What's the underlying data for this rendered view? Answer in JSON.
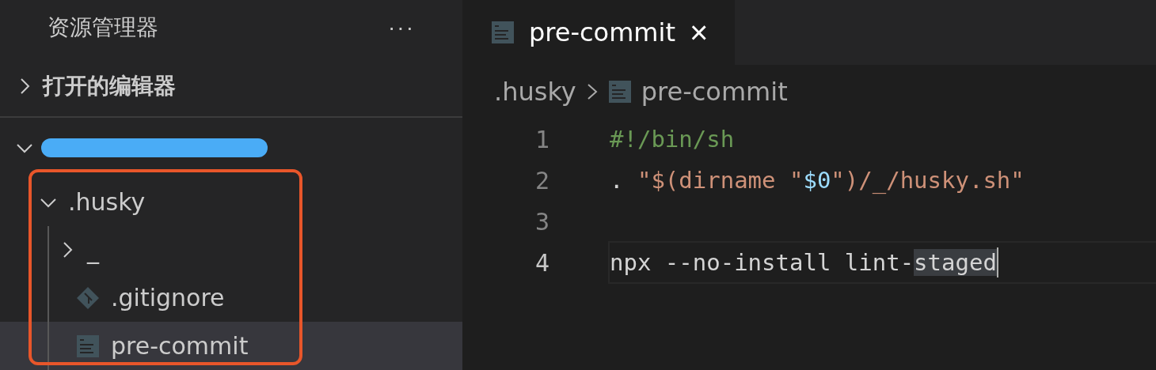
{
  "sidebar": {
    "title": "资源管理器",
    "more": "···",
    "sections": [
      {
        "label": "打开的编辑器",
        "expanded": false,
        "redacted": false
      },
      {
        "expanded": true,
        "redacted": true
      }
    ],
    "tree": [
      {
        "name": ".husky",
        "kind": "folder",
        "expanded": true,
        "selected": false,
        "outlined": true,
        "children": [
          {
            "name": "_",
            "kind": "folder",
            "expanded": false,
            "selected": false
          },
          {
            "name": ".gitignore",
            "kind": "git",
            "selected": false
          },
          {
            "name": "pre-commit",
            "kind": "text",
            "selected": true
          }
        ]
      }
    ]
  },
  "tabs": [
    {
      "label": "pre-commit",
      "selected": true,
      "close": "×"
    }
  ],
  "breadcrumb": [
    {
      "label": ".husky",
      "kind": "folder"
    },
    {
      "label": "pre-commit",
      "kind": "text"
    }
  ],
  "editor": {
    "lines": [
      {
        "number": "1",
        "current": false,
        "tokens": [
          {
            "text": "#!/bin/sh",
            "kind": "comment",
            "highlighted": false
          }
        ]
      },
      {
        "number": "2",
        "current": false,
        "tokens": [
          {
            "text": ". ",
            "kind": "plain",
            "highlighted": false
          },
          {
            "text": "\"$(dirname \"",
            "kind": "string",
            "highlighted": false
          },
          {
            "text": "$0",
            "kind": "variable",
            "highlighted": false
          },
          {
            "text": "\")/_/husky.sh\"",
            "kind": "string",
            "highlighted": false
          }
        ]
      },
      {
        "number": "3",
        "current": false
      },
      {
        "number": "4",
        "current": true,
        "tokens": [
          {
            "text": "npx --no-install lint-",
            "kind": "plain",
            "highlighted": false
          },
          {
            "text": "staged",
            "kind": "plain",
            "highlighted": true
          }
        ]
      }
    ]
  }
}
